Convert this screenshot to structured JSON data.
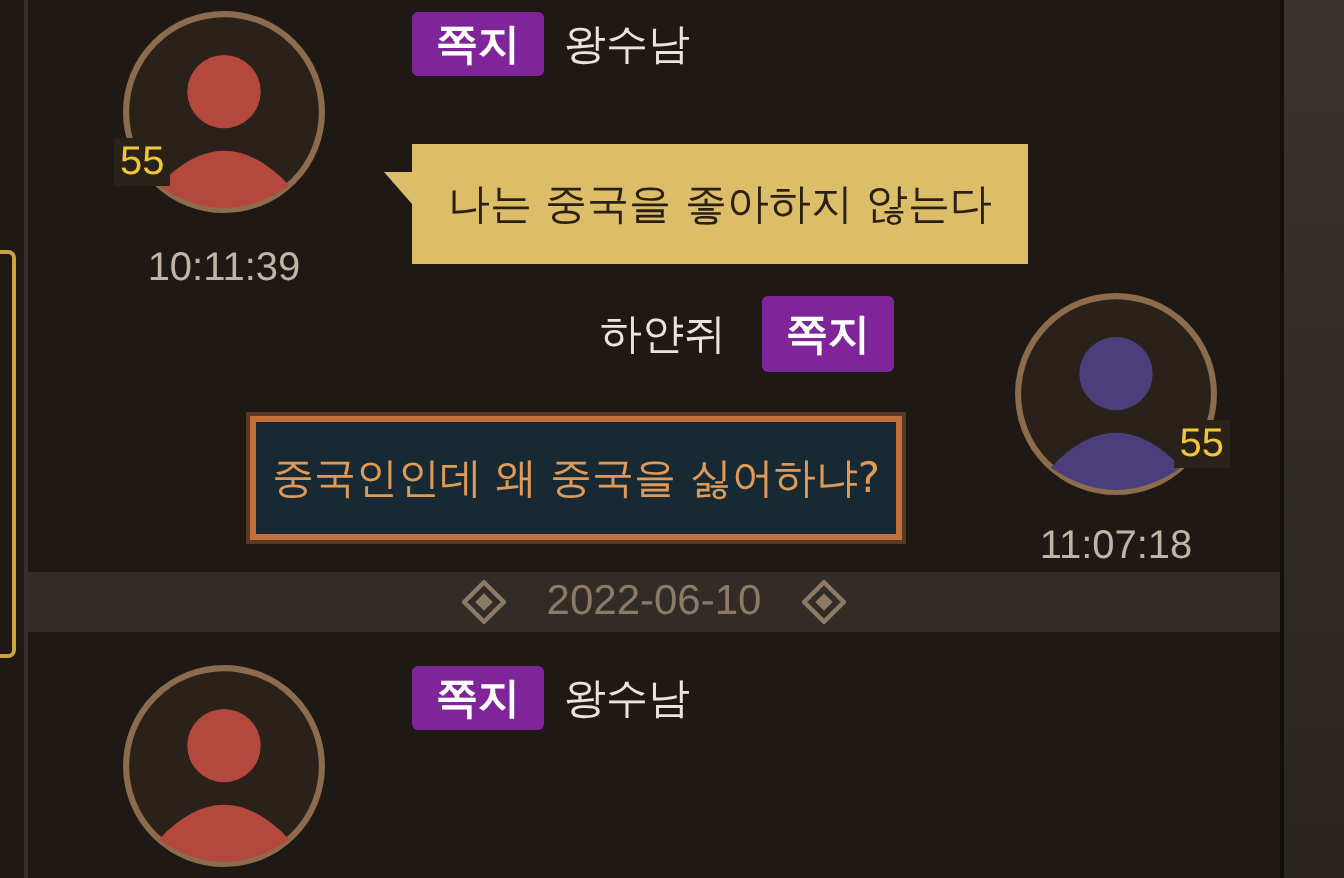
{
  "messages": [
    {
      "kind": "incoming",
      "tag": "쪽지",
      "sender": "왕수남",
      "badge": "55",
      "text": "나는 중국을 좋아하지 않는다",
      "time": "10:11:39"
    },
    {
      "kind": "outgoing",
      "tag": "쪽지",
      "sender": "하얀쥐",
      "badge": "55",
      "text": "중국인인데 왜 중국을 싫어하냐?",
      "time": "11:07:18"
    },
    {
      "kind": "date",
      "text": "2022-06-10"
    },
    {
      "kind": "incoming",
      "tag": "쪽지",
      "sender": "왕수남"
    }
  ]
}
